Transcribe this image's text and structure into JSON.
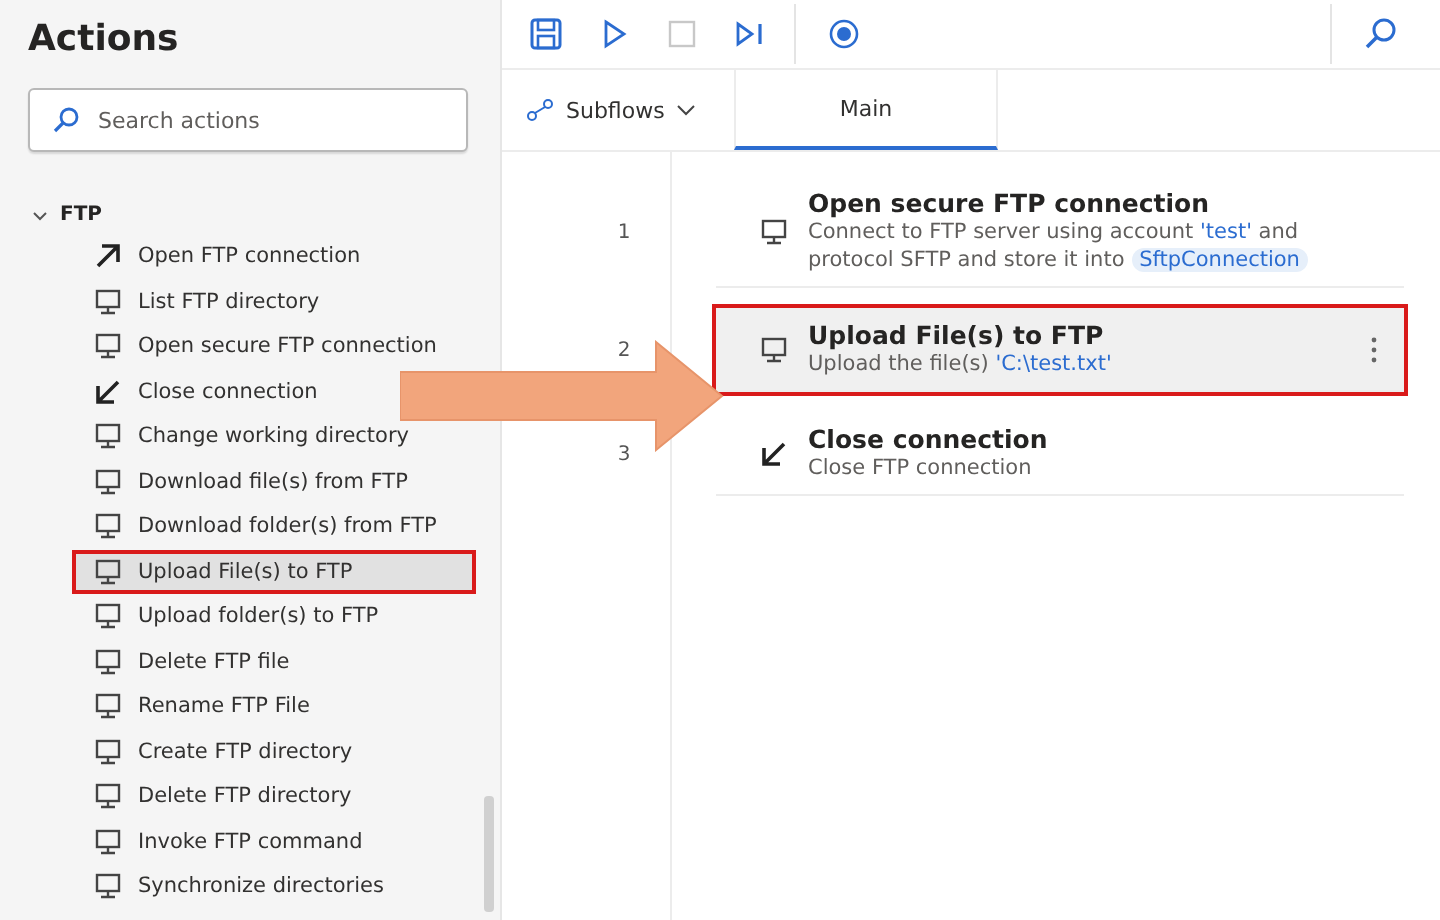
{
  "sidebar": {
    "title": "Actions",
    "search": {
      "placeholder": "Search actions"
    },
    "group": {
      "label": "FTP",
      "expanded": true,
      "items": [
        {
          "label": "Open FTP connection",
          "kind": "open",
          "selected": false,
          "annotated": false
        },
        {
          "label": "List FTP directory",
          "kind": "monitor",
          "selected": false,
          "annotated": false
        },
        {
          "label": "Open secure FTP connection",
          "kind": "monitor",
          "selected": false,
          "annotated": false
        },
        {
          "label": "Close connection",
          "kind": "close",
          "selected": false,
          "annotated": false
        },
        {
          "label": "Change working directory",
          "kind": "monitor",
          "selected": false,
          "annotated": false
        },
        {
          "label": "Download file(s) from FTP",
          "kind": "monitor",
          "selected": false,
          "annotated": false
        },
        {
          "label": "Download folder(s) from FTP",
          "kind": "monitor",
          "selected": false,
          "annotated": false
        },
        {
          "label": "Upload File(s) to FTP",
          "kind": "monitor",
          "selected": true,
          "annotated": true
        },
        {
          "label": "Upload folder(s) to FTP",
          "kind": "monitor",
          "selected": false,
          "annotated": false
        },
        {
          "label": "Delete FTP file",
          "kind": "monitor",
          "selected": false,
          "annotated": false
        },
        {
          "label": "Rename FTP File",
          "kind": "monitor",
          "selected": false,
          "annotated": false
        },
        {
          "label": "Create FTP directory",
          "kind": "monitor",
          "selected": false,
          "annotated": false
        },
        {
          "label": "Delete FTP directory",
          "kind": "monitor",
          "selected": false,
          "annotated": false
        },
        {
          "label": "Invoke FTP command",
          "kind": "monitor",
          "selected": false,
          "annotated": false
        },
        {
          "label": "Synchronize directories",
          "kind": "monitor",
          "selected": false,
          "annotated": false
        }
      ]
    }
  },
  "toolbar": {
    "buttons": [
      {
        "kind": "save",
        "disabled": false
      },
      {
        "kind": "run",
        "disabled": false
      },
      {
        "kind": "stop",
        "disabled": true
      },
      {
        "kind": "step",
        "disabled": false
      },
      {
        "kind": "record",
        "disabled": false
      }
    ]
  },
  "tabs": {
    "subflows": "Subflows",
    "items": [
      {
        "label": "Main",
        "selected": true
      }
    ]
  },
  "steps": [
    {
      "number": "1",
      "kind": "monitor",
      "title": "Open secure FTP connection",
      "selected": false,
      "annotated": false,
      "description": [
        {
          "kind": "text",
          "text": "Connect to FTP server using account "
        },
        {
          "kind": "literal",
          "text": "'test'"
        },
        {
          "kind": "text",
          "text": " and protocol SFTP and store it into "
        },
        {
          "kind": "variable",
          "text": "SftpConnection"
        }
      ]
    },
    {
      "number": "2",
      "kind": "monitor",
      "title": "Upload File(s) to FTP",
      "selected": true,
      "annotated": true,
      "description": [
        {
          "kind": "text",
          "text": "Upload the file(s) "
        },
        {
          "kind": "literal",
          "text": "'C:\\test.txt'"
        }
      ]
    },
    {
      "number": "3",
      "kind": "close",
      "title": "Close connection",
      "selected": false,
      "annotated": false,
      "description": [
        {
          "kind": "text",
          "text": "Close FTP connection"
        }
      ]
    }
  ],
  "annotation_arrow": {
    "kind": "arrow"
  }
}
